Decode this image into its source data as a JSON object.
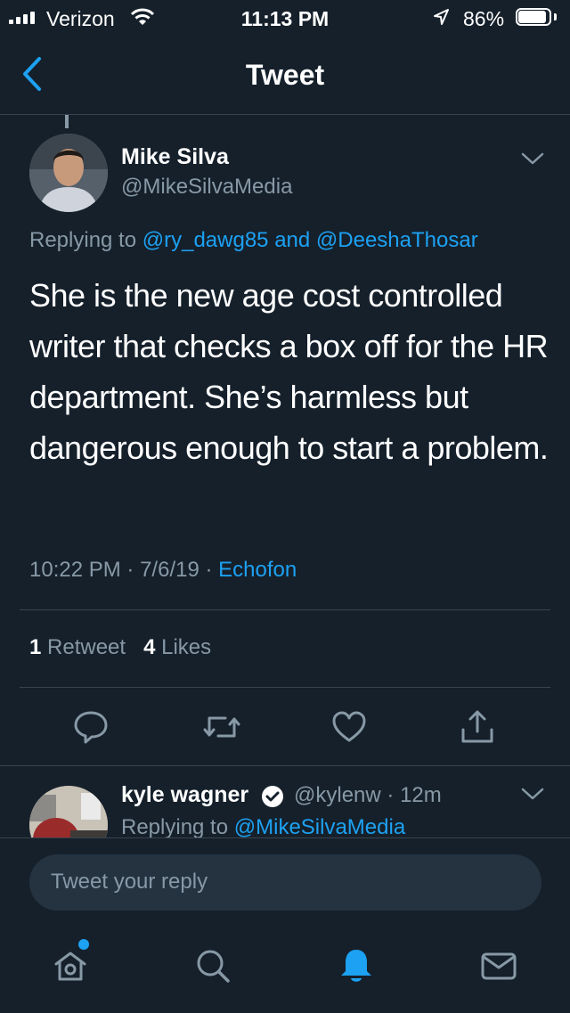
{
  "status_bar": {
    "carrier": "Verizon",
    "time": "11:13 PM",
    "battery": "86%"
  },
  "nav": {
    "title": "Tweet"
  },
  "tweet": {
    "author_name": "Mike Silva",
    "author_handle": "@MikeSilvaMedia",
    "replying_prefix": "Replying to",
    "replying_to": "@ry_dawg85 and @DeeshaThosar",
    "text": "She is the new age cost controlled writer that checks a box off for the HR department. She’s harmless but dangerous enough to start a problem.",
    "time": "10:22 PM",
    "date": "7/6/19",
    "source": "Echofon",
    "retweet_count": "1",
    "retweet_label": "Retweet",
    "like_count": "4",
    "like_label": "Likes"
  },
  "reply_preview": {
    "author_name": "kyle wagner",
    "author_handle": "@kylenw",
    "age": "12m",
    "replying_prefix": "Replying to",
    "replying_to": "@MikeSilvaMedia"
  },
  "compose": {
    "placeholder": "Tweet your reply"
  },
  "icons": {
    "back": "chevron-left-icon",
    "caret": "chevron-down-icon",
    "reply": "comment-icon",
    "retweet": "retweet-icon",
    "like": "heart-icon",
    "share": "share-icon",
    "home": "home-icon",
    "search": "search-icon",
    "notifications": "bell-icon",
    "messages": "mail-icon"
  },
  "colors": {
    "background": "#15202b",
    "accent": "#1da1f2",
    "muted": "#8899a6"
  }
}
